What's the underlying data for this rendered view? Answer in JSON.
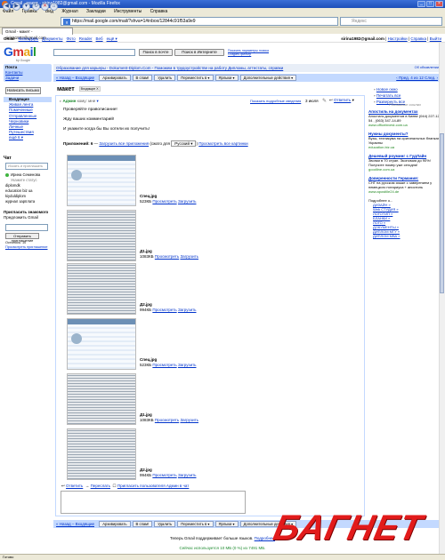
{
  "window": {
    "title": "Gmail - макет - sirina1982@gmail.com - Mozilla Firefox",
    "buttons": [
      "_",
      "□",
      "×"
    ]
  },
  "menu": [
    "Файл",
    "Правка",
    "Вид",
    "Журнал",
    "Закладки",
    "Инструменты",
    "Справка"
  ],
  "browser": {
    "url": "https://mail.google.com/mail/?shva=1#inbox/12844c91f53a9e9",
    "search_placeholder": "Яндекс",
    "tab_title": "Gmail - макет - sirina1982@gmail.com"
  },
  "gbar": {
    "items": [
      "Gmail",
      "Календарь",
      "Документы",
      "Фото",
      "Reader",
      "Веб",
      "ещё ▾"
    ],
    "email": "sirina1982@gmail.com",
    "right_links": [
      "Настройки",
      "Справка",
      "Выйти"
    ]
  },
  "logo": {
    "letters": [
      "G",
      "m",
      "a",
      "i",
      "l"
    ],
    "sub": "by Google"
  },
  "search": {
    "mail_button": "Поиск в почте",
    "web_button": "Поиск в Интернете",
    "options": "Показать параметры поиска",
    "create_filter": "Создать фильтр"
  },
  "sidebar": {
    "compose": "Написать письмо",
    "items": [
      "Входящие",
      "Живая лента",
      "Помеченные",
      "Отправленные",
      "Черновики",
      "Личные",
      "Путешествия",
      "ещё 6 ▾"
    ],
    "top_links": [
      "Почта",
      "Контакты",
      "Задачи"
    ]
  },
  "chat": {
    "header": "Чат",
    "search_placeholder": "Искать и приглашать",
    "contacts": [
      "Ирина Семенова",
      "Укажите статус",
      "diplomdk",
      "education biz ua",
      "kiyduldiplom",
      "журнал зарплата"
    ]
  },
  "invite": {
    "header": "Пригласить знакомого",
    "sub": "Предложить Gmail",
    "button": "Отправить приглашение",
    "left": "Осталось: 10",
    "preview": "Просмотреть приглашение"
  },
  "adbar": {
    "text": "Образование для карьеры - Dokument-Diplom.Com - Поможем в трудоустройстве на работу Дипломы, аттестаты, справки",
    "right": "Об объявлении"
  },
  "toolbar": {
    "back": "« Назад – Входящие",
    "buttons": [
      "Архивировать",
      "В спам!",
      "Удалить",
      "Переместить в ▾",
      "Ярлыки ▾",
      "Дополнительные действия ▾"
    ],
    "pager": "‹ Пред. 4 из 12 След. ›"
  },
  "message": {
    "subject": "макет",
    "label": "Входящие X",
    "show_details": "Показать подробные сведения",
    "date": "3 июля",
    "from": "Админ",
    "to": "кому: мне",
    "reply": "Ответить",
    "body": [
      "Проверяйте правописание!",
      "Жду ваших комментарий!",
      "И укажите когда бы Вы хотели их получить!"
    ],
    "attachments_line": {
      "label": "Приложений: 6",
      "download_all": "Загрузить все приложения",
      "zip_in": "(сжато для",
      "lang": "Русский ▾",
      "view_all": "Просмотреть все картинки"
    },
    "attachments": [
      {
        "name": "Спец.jpg",
        "size": "523КБ",
        "view": "Просмотреть",
        "download": "Загрузить",
        "style": "A"
      },
      {
        "name": "Д1.jpg",
        "size": "1083КБ",
        "view": "Просмотреть",
        "download": "Загрузить",
        "style": "B"
      },
      {
        "name": "Д2.jpg",
        "size": "994КБ",
        "view": "Просмотреть",
        "download": "Загрузить",
        "style": "B"
      },
      {
        "name": "Спец.jpg",
        "size": "523КБ",
        "view": "Просмотреть",
        "download": "Загрузить",
        "style": "A"
      },
      {
        "name": "Д1.jpg",
        "size": "1083КБ",
        "view": "Просмотреть",
        "download": "Загрузить",
        "style": "B"
      },
      {
        "name": "Д2.jpg",
        "size": "994КБ",
        "view": "Просмотреть",
        "download": "Загрузить",
        "style": "B"
      }
    ],
    "actions": [
      "Ответить",
      "Переслать",
      "Пригласить пользователя Админ в чат"
    ]
  },
  "right": {
    "links": [
      "Новое окно",
      "Печатать все",
      "Развернуть все"
    ],
    "ads_title": "Рекламные ссылки",
    "ads": [
      {
        "h": "Апостиль на документах",
        "t": "Апостиль документов в Киеве (044) 227-12-54 , (063) 347-14-89",
        "url": "www.officeinvest.com.ua"
      },
      {
        "h": "Нужны документы?",
        "t": "Вузы, техникума на оригинальных бланках Украины",
        "url": "education.biz.ua"
      },
      {
        "h": "Дешевый роуминг с ГудЛайн",
        "t": "Звонки в 70 стран. Экономия до 90%! Получите номер уже сегодня!",
        "url": "goodline.com.ua"
      },
      {
        "h": "Доверенности Германия:",
        "t": "СНГ на русском языке с заверением у немецкого нотариуса + апостиль",
        "url": "www.apostille24.de"
      }
    ],
    "related_title": "Подробнее о...",
    "related": [
      "ДИЗАЙН »",
      "Web СТУДИЯ »",
      "ЛОГОТИП »",
      "БЛАНКИ »",
      "ЛОГО »",
      "ДОКУМЕНТЫ »",
      "ДИПЛОМ МГУ »",
      "ДИПЛОМ МВА »"
    ]
  },
  "footer": {
    "text": "Теперь Gmail поддерживает больше языков.",
    "link": "Подробнее",
    "used": "Сейчас используется 10 МБ (0 %) из 7491 МБ."
  },
  "status": "Готово",
  "watermark": "БАГНЕТ"
}
